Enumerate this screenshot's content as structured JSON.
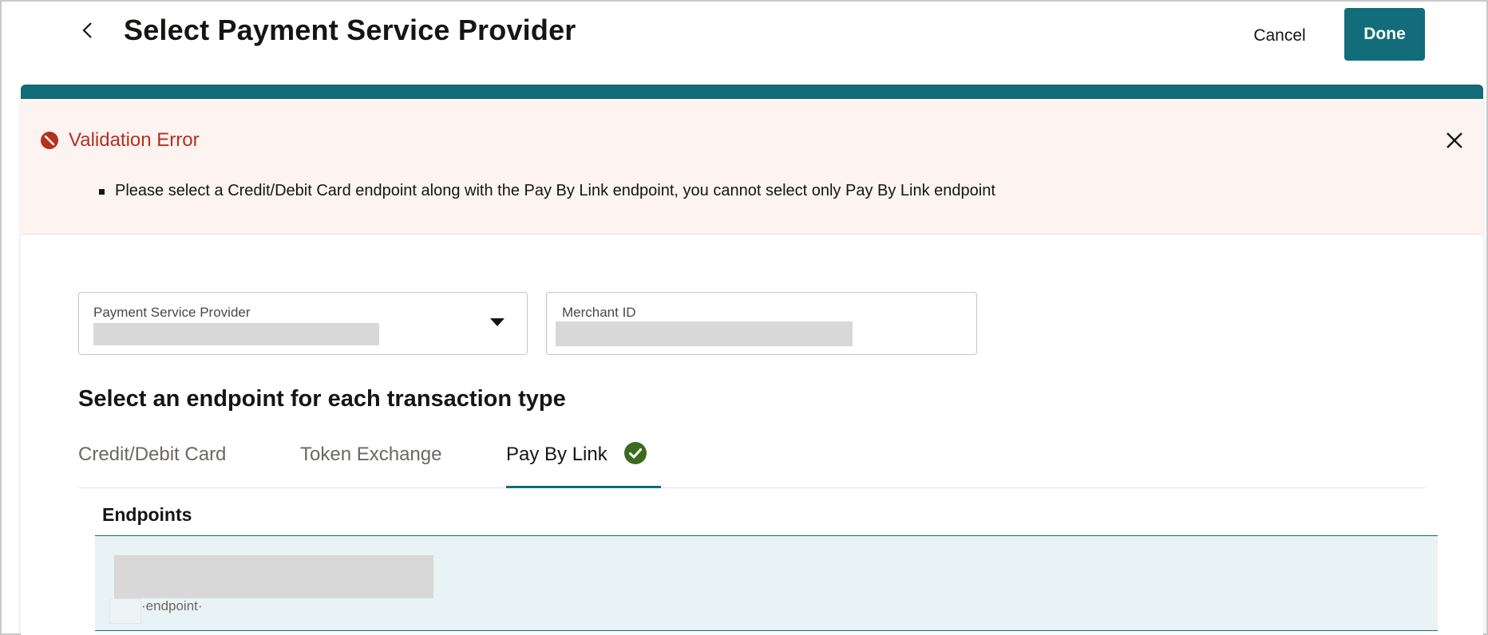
{
  "header": {
    "title": "Select Payment Service Provider",
    "cancel_label": "Cancel",
    "done_label": "Done",
    "back_icon": "chevron-left-icon"
  },
  "colors": {
    "accent": "#126c7a",
    "error": "#b3311f",
    "error_bg": "#fdf3f0",
    "success": "#3a6b1f",
    "selected_row_bg": "#e9f2f4"
  },
  "error_banner": {
    "title": "Validation Error",
    "icon": "error-circle-icon",
    "close_icon": "close-icon",
    "messages": [
      "Please select a Credit/Debit Card endpoint along with the Pay By Link endpoint, you cannot select only Pay By Link endpoint"
    ]
  },
  "form": {
    "psp_label": "Payment Service Provider",
    "merchant_id_label": "Merchant ID"
  },
  "section": {
    "heading": "Select an endpoint for each transaction type"
  },
  "tabs": [
    {
      "label": "Credit/Debit Card",
      "selected": false
    },
    {
      "label": "Token Exchange",
      "selected": false
    },
    {
      "label": "Pay By Link",
      "selected": true,
      "icon": "check-circle-icon"
    }
  ],
  "table": {
    "header": "Endpoints",
    "rows": [
      {
        "sub_label": "·endpoint·",
        "selected": true
      }
    ]
  }
}
